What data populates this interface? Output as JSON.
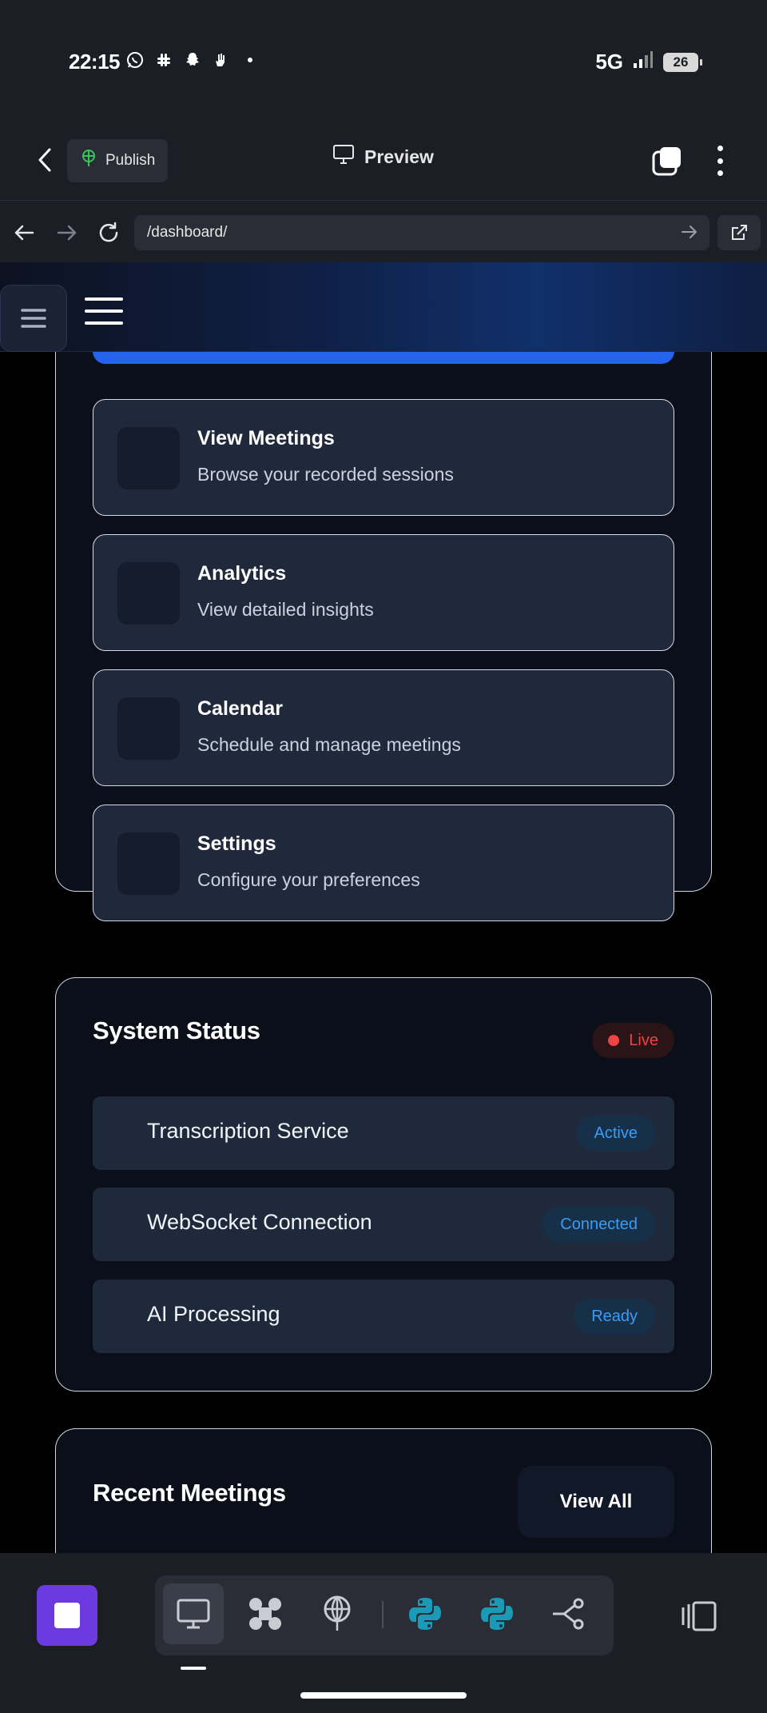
{
  "status_bar": {
    "time": "22:15",
    "network": "5G",
    "battery": "26",
    "left_icons": [
      "whatsapp-icon",
      "slack-icon",
      "snapchat-icon",
      "hand-icon",
      "dot-icon"
    ]
  },
  "app_header": {
    "publish_label": "Publish",
    "preview_label": "Preview"
  },
  "url_bar": {
    "path": "/dashboard/"
  },
  "quick_actions": [
    {
      "title": "View Meetings",
      "subtitle": "Browse your recorded sessions"
    },
    {
      "title": "Analytics",
      "subtitle": "View detailed insights"
    },
    {
      "title": "Calendar",
      "subtitle": "Schedule and manage meetings"
    },
    {
      "title": "Settings",
      "subtitle": "Configure your preferences"
    }
  ],
  "system_status": {
    "title": "System Status",
    "live_label": "Live",
    "services": [
      {
        "name": "Transcription Service",
        "status": "Active"
      },
      {
        "name": "WebSocket Connection",
        "status": "Connected"
      },
      {
        "name": "AI Processing",
        "status": "Ready"
      }
    ]
  },
  "recent_meetings": {
    "title": "Recent Meetings",
    "view_all_label": "View All"
  },
  "colors": {
    "accent_blue": "#2563eb",
    "live_red": "#ef4444",
    "status_blue": "#3b9cf6",
    "stop_purple": "#6d3ae0",
    "python_teal": "#1b9ab7"
  },
  "dock": {
    "items": [
      "desktop-icon",
      "apps-grid-icon",
      "publish-icon",
      "python-icon",
      "python-icon",
      "share-graph-icon"
    ]
  }
}
